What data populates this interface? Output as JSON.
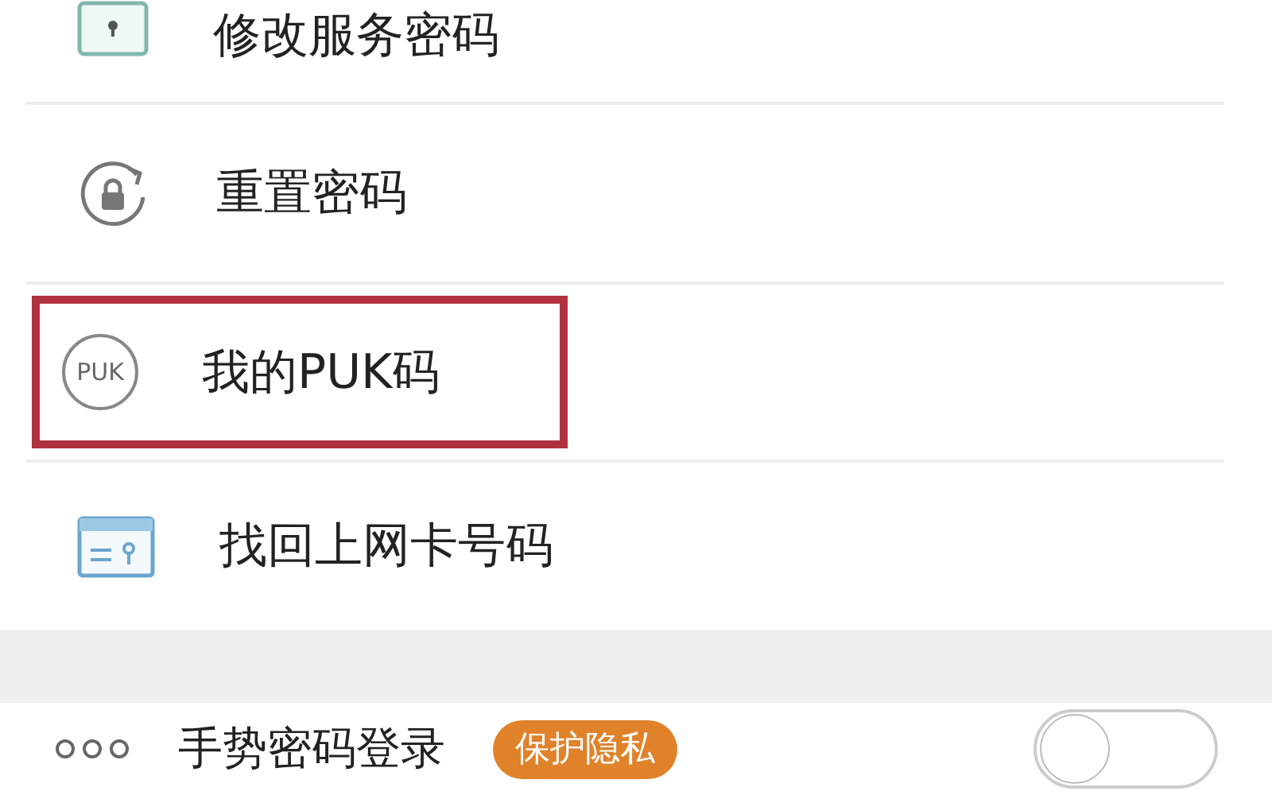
{
  "menu_items": [
    {
      "label": "修改服务密码",
      "kind": "card",
      "highlighted": false
    },
    {
      "label": "重置密码",
      "kind": "reset",
      "highlighted": false
    },
    {
      "label": "我的PUK码",
      "kind": "badge",
      "icon_text": "PUK",
      "highlighted": true
    },
    {
      "label": "找回上网卡号码",
      "kind": "sim",
      "highlighted": false
    }
  ],
  "gesture_login": {
    "label": "手势密码登录",
    "badge": "保护隐私",
    "on": false
  }
}
